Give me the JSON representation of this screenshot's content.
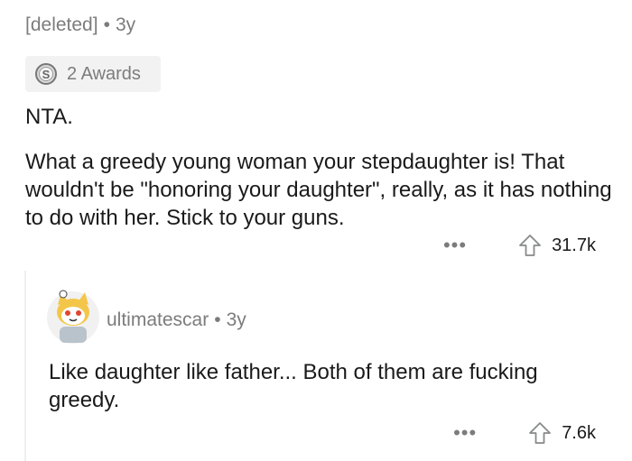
{
  "comment": {
    "author": "[deleted]",
    "age": "3y",
    "awards_label": "2 Awards",
    "verdict": "NTA.",
    "text": "What a greedy young woman your stepdaughter is! That wouldn't be \"honoring your daughter\", really, as it has nothing to do with her. Stick to your guns.",
    "more": "•••",
    "upvotes": "31.7k"
  },
  "reply": {
    "author": "ultimatescar",
    "age": "3y",
    "text": "Like daughter like father... Both of them are fucking greedy.",
    "more": "•••",
    "upvotes": "7.6k"
  },
  "separator": "•"
}
